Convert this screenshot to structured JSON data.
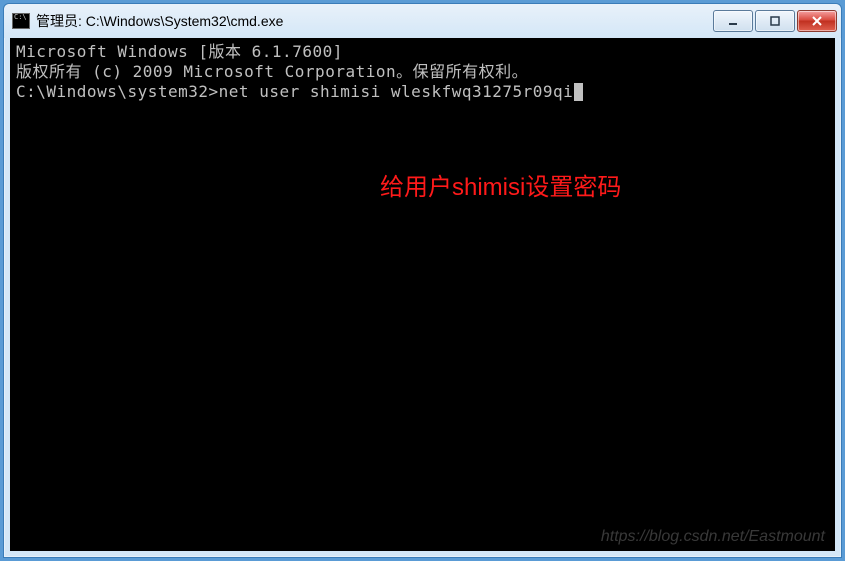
{
  "window": {
    "title": "管理员: C:\\Windows\\System32\\cmd.exe"
  },
  "terminal": {
    "line1": "Microsoft Windows [版本 6.1.7600]",
    "line2": "版权所有 (c) 2009 Microsoft Corporation。保留所有权利。",
    "blank": "",
    "prompt": "C:\\Windows\\system32>",
    "command": "net user shimisi wleskfwq31275r09qi"
  },
  "annotation": "给用户shimisi设置密码",
  "watermark": "https://blog.csdn.net/Eastmount"
}
